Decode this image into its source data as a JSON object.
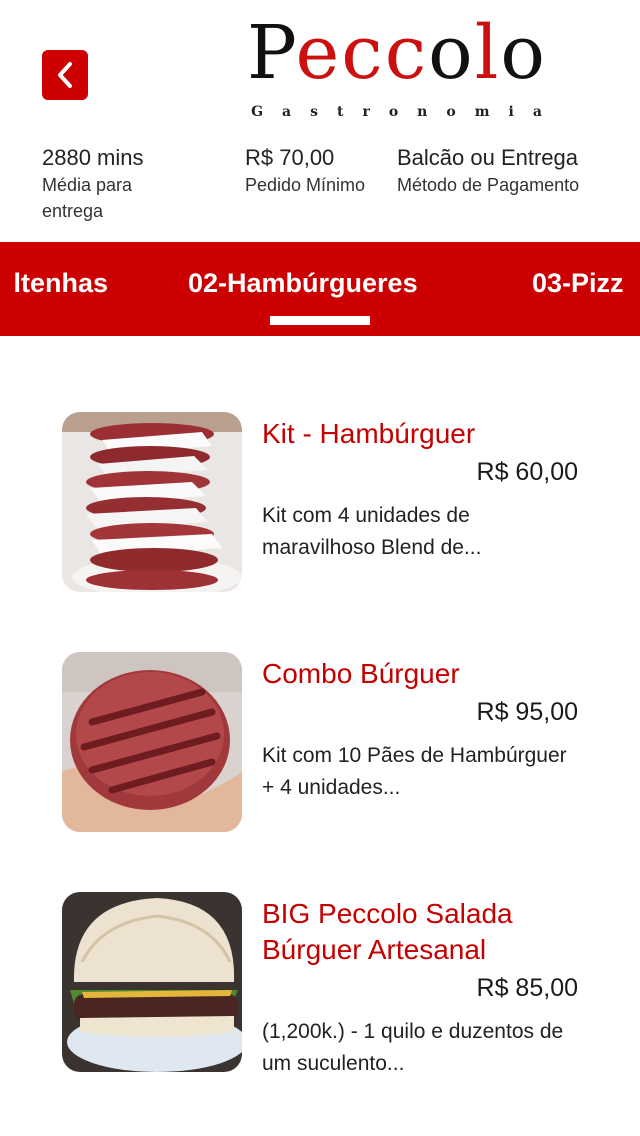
{
  "header": {
    "logo_text": "Peccolo",
    "logo_subtitle": "Gastronomia"
  },
  "info": [
    {
      "value": "2880 mins",
      "label": "Média para entrega"
    },
    {
      "value": "R$ 70,00",
      "label": "Pedido Mínimo"
    },
    {
      "value": "Balcão ou Entrega",
      "label": "Método de Pagamento"
    }
  ],
  "tabs": [
    {
      "label": "ltenhas"
    },
    {
      "label": "02-Hambúrgueres"
    },
    {
      "label": "03-Pizz"
    }
  ],
  "items": [
    {
      "title": "Kit - Hambúrguer",
      "price": "R$ 60,00",
      "description": "Kit com 4 unidades de maravilhoso Blend de..."
    },
    {
      "title": "Combo Búrguer",
      "price": "R$ 95,00",
      "description": "Kit com 10 Pães de Hambúrguer + 4 unidades..."
    },
    {
      "title": "BIG Peccolo Salada Búrguer Artesanal",
      "price": "R$ 85,00",
      "description": "(1,200k.) - 1 quilo e duzentos de um suculento..."
    }
  ],
  "colors": {
    "accent": "#cc0000"
  },
  "icons": {
    "back": "chevron-left-icon"
  }
}
